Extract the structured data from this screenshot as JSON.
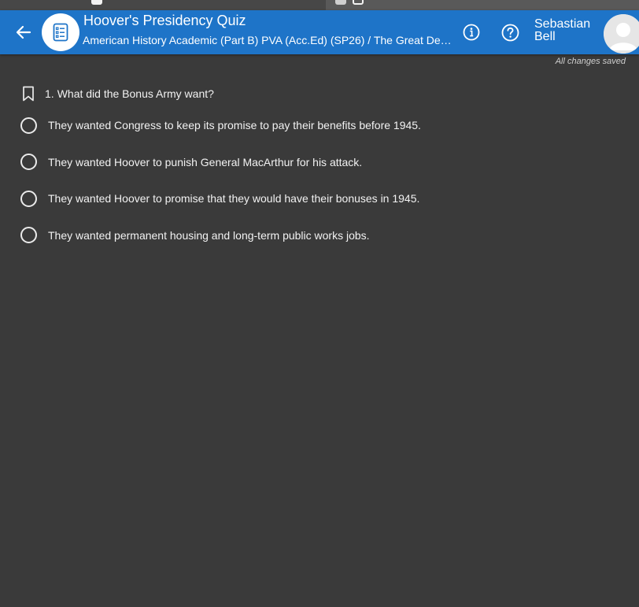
{
  "header": {
    "title": "Hoover's Presidency Quiz",
    "subtitle": "American History Academic (Part B) PVA (Acc.Ed) (SP26) / The Great De…",
    "user_name": "Sebastian Bell"
  },
  "status": {
    "saved_text": "All changes saved"
  },
  "question": {
    "number": "1.",
    "text": "What did the Bonus Army want?",
    "options": [
      "They wanted Congress to keep its promise to pay their benefits before 1945.",
      "They wanted Hoover to punish General MacArthur for his attack.",
      "They wanted Hoover to promise that they would have their bonuses in 1945.",
      "They wanted permanent housing and long-term public works jobs."
    ]
  },
  "icons": {
    "back": "arrow-left-icon",
    "app": "checklist-icon",
    "info": "info-icon",
    "help": "help-icon",
    "avatar": "user-avatar",
    "bookmark": "bookmark-icon"
  },
  "colors": {
    "header": "#1e74c8",
    "background": "#3a3a3a",
    "text": "#f2f2f2"
  }
}
